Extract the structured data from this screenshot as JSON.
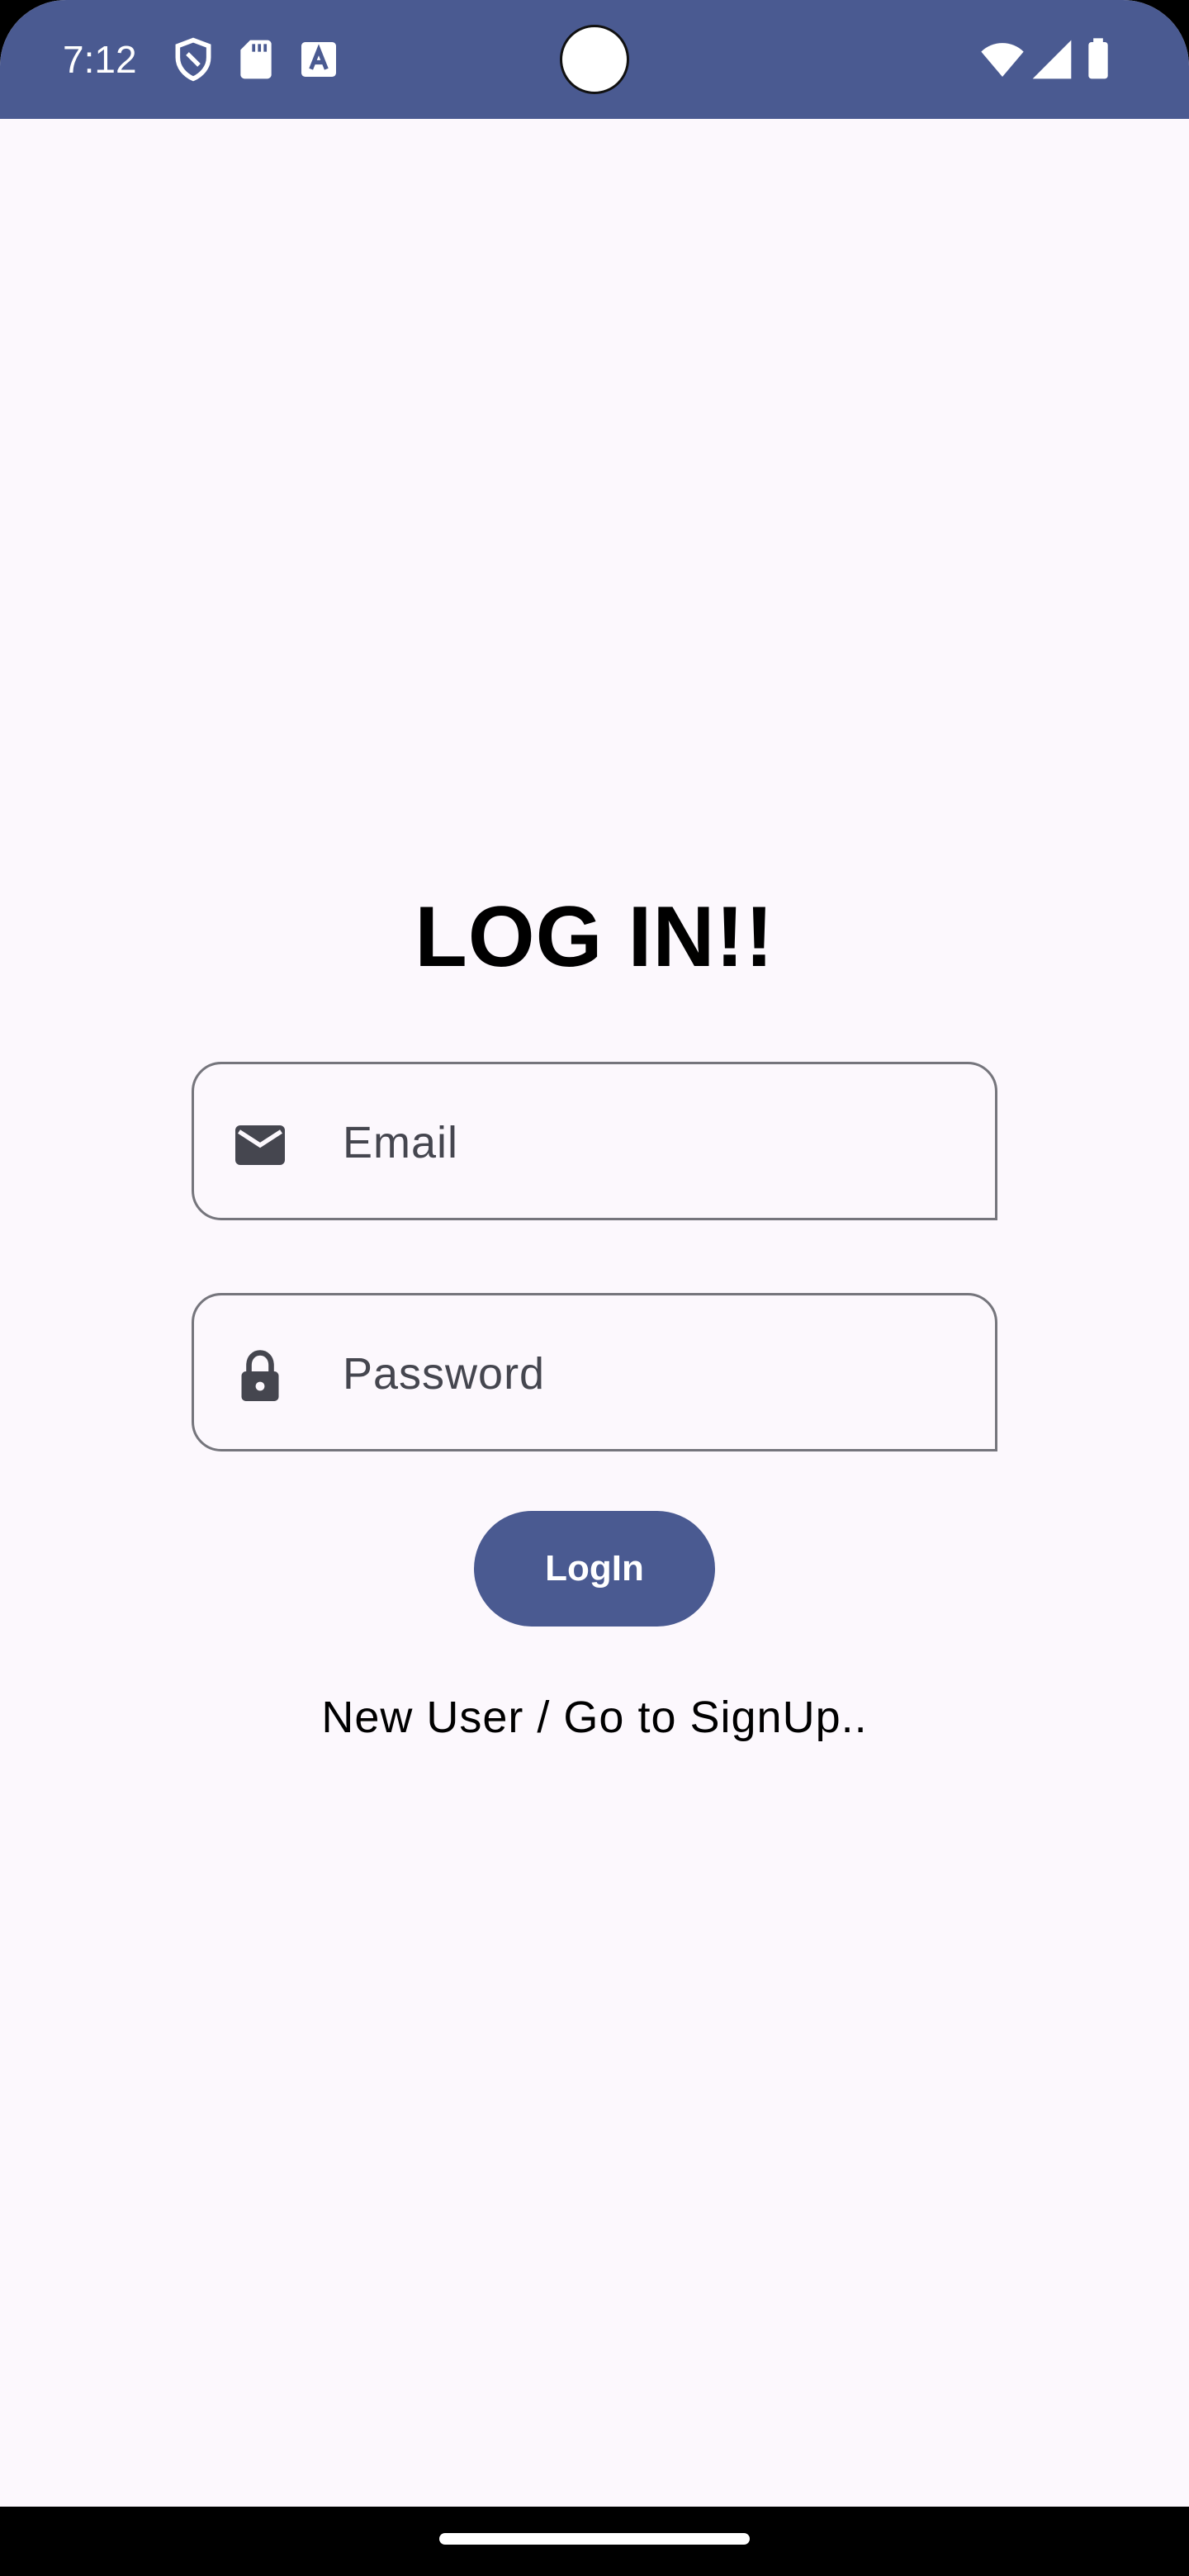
{
  "status_bar": {
    "time": "7:12",
    "icons": [
      "shield-icon",
      "sd-card-icon",
      "text-a-icon",
      "wifi-icon",
      "signal-icon",
      "battery-icon"
    ],
    "color": "#4A5A91"
  },
  "login": {
    "title": "LOG IN!!",
    "email": {
      "placeholder": "Email",
      "icon": "email-icon"
    },
    "password": {
      "placeholder": "Password",
      "icon": "lock-icon"
    },
    "button_label": "LogIn",
    "signup_link": "New User / Go to SignUp.."
  },
  "colors": {
    "accent": "#4A5A91",
    "background": "#FCF8FD",
    "field_border": "#75757C",
    "field_text": "#45464F"
  }
}
